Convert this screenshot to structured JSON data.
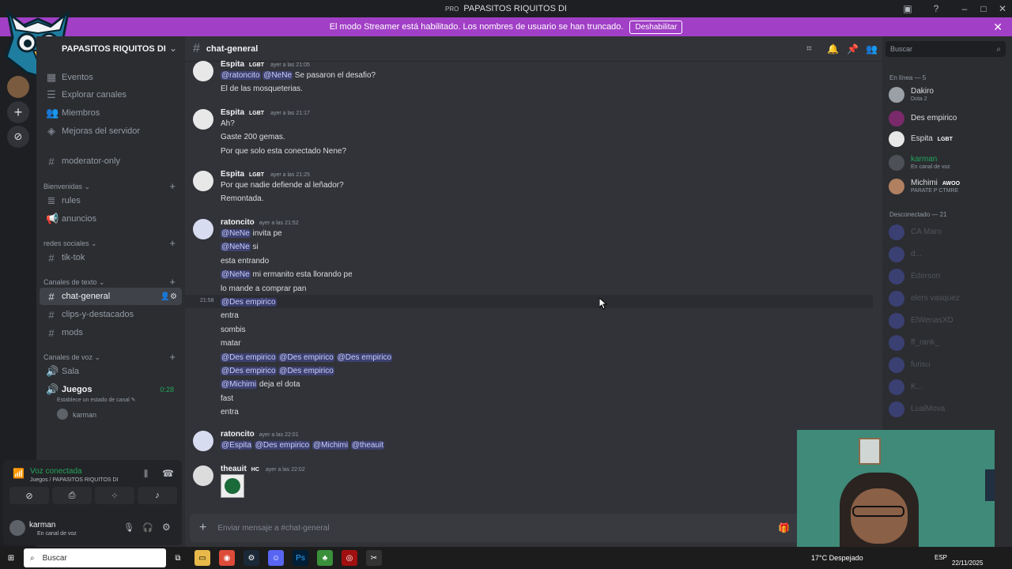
{
  "window": {
    "badge": "PRO",
    "title": "PAPASITOS RIQUITOS DI"
  },
  "streamer_banner": {
    "text": "El modo Streamer está habilitado. Los nombres de usuario se han truncado.",
    "button": "Deshabilitar"
  },
  "server": {
    "name": "PAPASITOS RIQUITOS DI",
    "top_items": [
      {
        "label": "Eventos",
        "icon": "calendar-icon"
      },
      {
        "label": "Explorar canales",
        "icon": "list-icon"
      },
      {
        "label": "Miembros",
        "icon": "members-icon"
      },
      {
        "label": "Mejoras del servidor",
        "icon": "boost-icon"
      }
    ],
    "moderator": "moderator-only",
    "categories": [
      {
        "name": "Bienvenidas",
        "channels": [
          "rules",
          "anuncios"
        ]
      },
      {
        "name": "redes sociales",
        "channels": [
          "tik-tok"
        ]
      },
      {
        "name": "Canales de texto",
        "channels": [
          "chat-general",
          "clips-y-destacados",
          "mods"
        ]
      },
      {
        "name": "Canales de voz",
        "channels": [
          "Sala",
          "Juegos"
        ]
      }
    ],
    "voice_timer": "0:28",
    "voice_status": "Establece un estado de canal",
    "voice_user": "karman"
  },
  "voice_panel": {
    "title": "Voz conectada",
    "subtitle": "Juegos / PAPASITOS RIQUITOS DI"
  },
  "user_panel": {
    "name": "karman",
    "status": "En canal de voz"
  },
  "chat": {
    "channel": "chat-general",
    "search_placeholder": "Buscar",
    "composer_placeholder": "Enviar mensaje a #chat-general",
    "hover_time": "21:58",
    "groups": [
      {
        "author": "Espita",
        "tag": "LGBT",
        "time": "ayer a las 21:05",
        "lines": [
          {
            "mentions": [
              "@ratoncito",
              "@NeNe"
            ],
            "text": "Se pasaron el desafio?"
          },
          {
            "mentions": [],
            "text": "El de las mosqueterias."
          }
        ]
      },
      {
        "author": "Espita",
        "tag": "LGBT",
        "time": "ayer a las 21:17",
        "lines": [
          {
            "mentions": [],
            "text": "Ah?"
          },
          {
            "mentions": [],
            "text": "Gaste 200 gemas."
          },
          {
            "mentions": [],
            "text": "Por que solo esta conectado Nene?"
          }
        ]
      },
      {
        "author": "Espita",
        "tag": "LGBT",
        "time": "ayer a las 21:25",
        "lines": [
          {
            "mentions": [],
            "text": "Por que nadie defiende al leñador?"
          },
          {
            "mentions": [],
            "text": "Remontada."
          }
        ]
      },
      {
        "author": "ratoncito",
        "tag": "",
        "time": "ayer a las 21:52",
        "lines": [
          {
            "mentions": [
              "@NeNe"
            ],
            "text": "invita pe"
          },
          {
            "mentions": [
              "@NeNe"
            ],
            "text": "si"
          },
          {
            "mentions": [],
            "text": "esta entrando"
          },
          {
            "mentions": [
              "@NeNe"
            ],
            "text": "mi ermanito esta llorando pe"
          },
          {
            "mentions": [],
            "text": "lo mande a comprar pan"
          },
          {
            "mentions": [
              "@Des empirico"
            ],
            "text": ""
          },
          {
            "mentions": [],
            "text": "entra"
          },
          {
            "mentions": [],
            "text": "sombis"
          },
          {
            "mentions": [],
            "text": "matar"
          },
          {
            "mentions": [
              "@Des empirico",
              "@Des empirico",
              "@Des empirico"
            ],
            "text": ""
          },
          {
            "mentions": [
              "@Des empirico",
              "@Des empirico"
            ],
            "text": ""
          },
          {
            "mentions": [
              "@Michimi"
            ],
            "text": "deja el dota"
          },
          {
            "mentions": [],
            "text": "fast"
          },
          {
            "mentions": [],
            "text": "entra"
          }
        ]
      },
      {
        "author": "ratoncito",
        "tag": "",
        "time": "ayer a las 22:01",
        "lines": [
          {
            "mentions": [
              "@Espita",
              "@Des empirico",
              "@Michimi",
              "@theauit"
            ],
            "text": ""
          }
        ]
      },
      {
        "author": "theauit",
        "tag": "HC",
        "time": "ayer a las 22:02",
        "lines": []
      }
    ]
  },
  "members": {
    "search": "Buscar",
    "online_header": "En línea — 5",
    "online": [
      {
        "name": "Dakiro",
        "status": "Dota 2",
        "tag": ""
      },
      {
        "name": "Des empirico",
        "status": "",
        "tag": ""
      },
      {
        "name": "Espita",
        "status": "",
        "tag": "LGBT"
      },
      {
        "name": "karman",
        "status": "En canal de voz",
        "tag": ""
      },
      {
        "name": "Michimi",
        "status": "PARATE P CTMRE",
        "tag": "AWOO"
      }
    ],
    "offline_header": "Desconectado — 21",
    "offline": [
      {
        "name": "CA Maro"
      },
      {
        "name": "d..."
      },
      {
        "name": "Ederson"
      },
      {
        "name": "elers vasquez"
      },
      {
        "name": "ElWenasXD"
      },
      {
        "name": "ff_rank_"
      },
      {
        "name": "furisu"
      },
      {
        "name": "K..."
      },
      {
        "name": "LualMova"
      }
    ]
  },
  "taskbar": {
    "search": "Buscar",
    "weather": "17°C  Despejado",
    "lang": "ESP",
    "date": "22/11/2025"
  }
}
